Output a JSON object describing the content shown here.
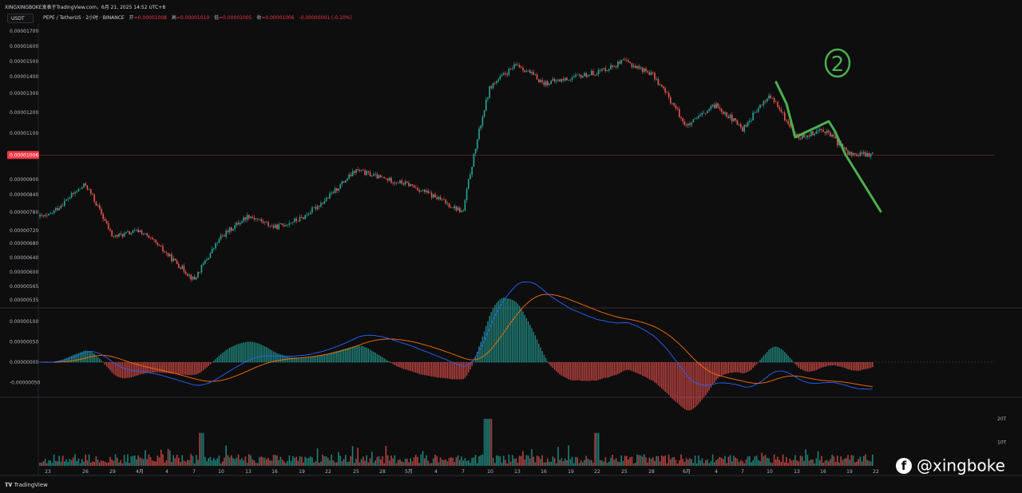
{
  "header": {
    "publisher": "XINGXINGBOKE发表于TradingView.com，6月 21, 2025 14:52 UTC+8"
  },
  "legend": {
    "symbol": "PEPE / TetherUS · 2小时 · BINANCE",
    "open_label": "开",
    "open": "=0.00001008",
    "high_label": "高",
    "high": "=0.00001010",
    "low_label": "低",
    "low": "=0.00001005",
    "close_label": "收",
    "close": "=0.00001006",
    "change": "-0.00000001 (-0.10%)"
  },
  "unit_button": "USDT",
  "price_badge": "0.00001006",
  "footer_brand": "TradingView",
  "watermark": "@xingboke",
  "colors": {
    "up": "#26a69a",
    "down": "#ef5350",
    "price_line": "#d32f2f",
    "annotation": "#4caf50",
    "macd": "#2962ff",
    "signal": "#ff6d00"
  },
  "chart_data": [
    {
      "type": "candlestick",
      "title": "PEPE / TetherUS",
      "y_ticks": [
        "0.00001700",
        "0.00001600",
        "0.00001500",
        "0.00001400",
        "0.00001300",
        "0.00001200",
        "0.00001100",
        "0.00000900",
        "0.00000840",
        "0.00000780",
        "0.00000720",
        "0.00000680",
        "0.00000640",
        "0.00000600",
        "0.00000565",
        "0.00000535"
      ],
      "y_tick_values": [
        1700,
        1600,
        1500,
        1400,
        1300,
        1200,
        1100,
        900,
        840,
        780,
        720,
        680,
        640,
        600,
        565,
        535
      ],
      "x_ticks": [
        "23",
        "26",
        "29",
        "4月",
        "4",
        "7",
        "10",
        "13",
        "16",
        "19",
        "22",
        "25",
        "28",
        "5月",
        "4",
        "7",
        "10",
        "13",
        "16",
        "19",
        "22",
        "25",
        "28",
        "6月",
        "4",
        "7",
        "10",
        "13",
        "16",
        "19",
        "22"
      ],
      "price_path": [
        {
          "x": "23",
          "y": 765
        },
        {
          "x": "26",
          "y": 880
        },
        {
          "x": "29",
          "y": 700
        },
        {
          "x": "4月",
          "y": 720
        },
        {
          "x": "4",
          "y": 650
        },
        {
          "x": "7",
          "y": 580
        },
        {
          "x": "10",
          "y": 700
        },
        {
          "x": "13",
          "y": 770
        },
        {
          "x": "16",
          "y": 730
        },
        {
          "x": "19",
          "y": 760
        },
        {
          "x": "22",
          "y": 830
        },
        {
          "x": "25",
          "y": 940
        },
        {
          "x": "28",
          "y": 905
        },
        {
          "x": "5月",
          "y": 880
        },
        {
          "x": "4",
          "y": 830
        },
        {
          "x": "7",
          "y": 780
        },
        {
          "x": "10",
          "y": 1340
        },
        {
          "x": "13",
          "y": 1480
        },
        {
          "x": "16",
          "y": 1360
        },
        {
          "x": "19",
          "y": 1390
        },
        {
          "x": "22",
          "y": 1430
        },
        {
          "x": "25",
          "y": 1500
        },
        {
          "x": "28",
          "y": 1420
        },
        {
          "x": "6月",
          "y": 1130
        },
        {
          "x": "4",
          "y": 1240
        },
        {
          "x": "7",
          "y": 1120
        },
        {
          "x": "10",
          "y": 1290
        },
        {
          "x": "13",
          "y": 1080
        },
        {
          "x": "16",
          "y": 1120
        },
        {
          "x": "19",
          "y": 1010
        },
        {
          "x": "22",
          "y": 1006
        }
      ],
      "last_price": 1006,
      "price_scale_unit": "1e-8 USDT"
    },
    {
      "type": "line",
      "name": "MACD",
      "y_ticks": [
        "0.00000100",
        "0.00000050",
        "0.00000000",
        "-0.00000050"
      ],
      "y_tick_values": [
        100,
        50,
        0,
        -50
      ]
    },
    {
      "type": "bar",
      "name": "Volume",
      "y_ticks": [
        "20T",
        "10T"
      ],
      "y_tick_values": [
        20,
        10
      ]
    }
  ],
  "annotation": {
    "label": "2"
  }
}
